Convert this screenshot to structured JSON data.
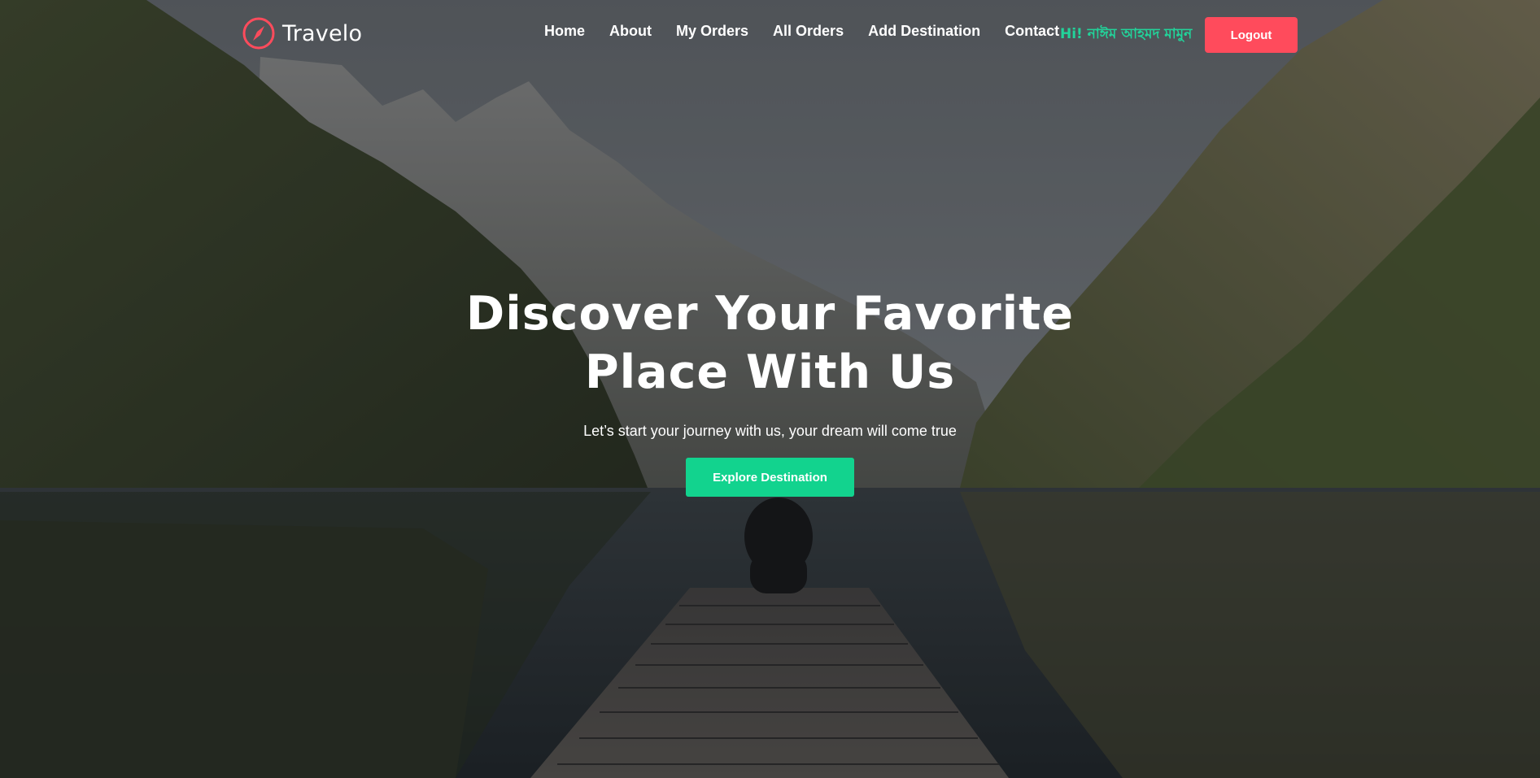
{
  "brand": {
    "name": "Travelo",
    "icon": "compass-icon",
    "accent_color": "#ff4b5c"
  },
  "nav": {
    "items": [
      {
        "label": "Home"
      },
      {
        "label": "About"
      },
      {
        "label": "My Orders"
      },
      {
        "label": "All Orders"
      },
      {
        "label": "Add Destination"
      },
      {
        "label": "Contact"
      }
    ],
    "greeting": "Hi! নাঈম আহমদ মামুন",
    "greeting_color": "#22d39a",
    "logout_label": "Logout",
    "logout_color": "#ff4b5c"
  },
  "hero": {
    "title": "Discover Your Favorite Place With Us",
    "subtitle": "Let’s start your journey with us, your dream will come true",
    "cta_label": "Explore Destination",
    "cta_color": "#12d38e",
    "background": "mountain-lake-dock-photo"
  }
}
